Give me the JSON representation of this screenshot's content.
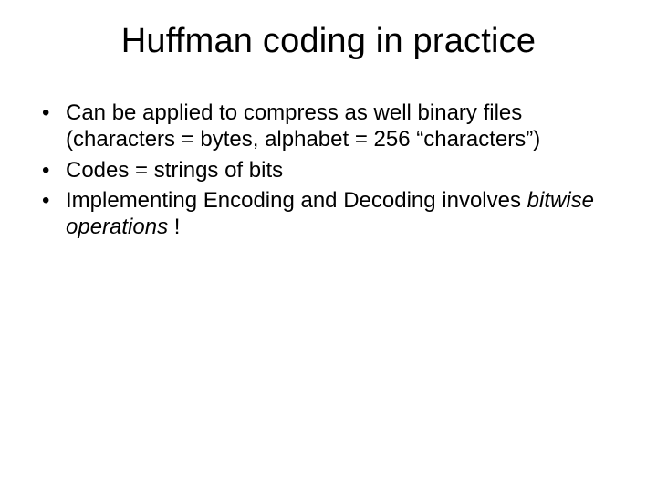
{
  "title": "Huffman coding in practice",
  "bullets": {
    "b1a": "Can be applied to compress as well binary files (characters = bytes, alphabet =  256 ",
    "b1b": "“characters”",
    "b1c": ")",
    "b2": "Codes = strings of bits",
    "b3a": "Implementing Encoding and Decoding involves ",
    "b3b": "bitwise operations",
    "b3c": " !"
  }
}
